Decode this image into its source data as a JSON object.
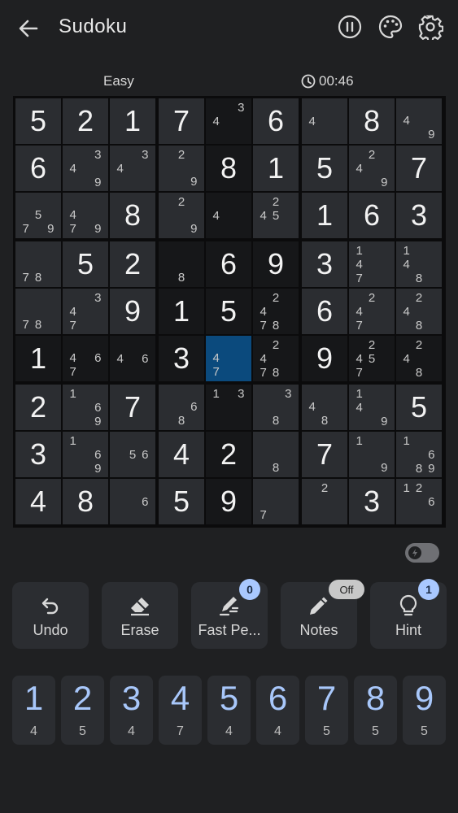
{
  "app": {
    "title": "Sudoku"
  },
  "toolbar": {
    "back_icon": "arrow-left-icon",
    "pause_icon": "pause-icon",
    "theme_icon": "palette-icon",
    "settings_icon": "gear-icon"
  },
  "status": {
    "difficulty": "Easy",
    "timer": "00:46"
  },
  "colors": {
    "background": "#1f2022",
    "cell_prefilled": "#2b2d31",
    "cell_dark": "#161719",
    "cell_selected": "#0b4a7d",
    "accent": "#a8c7fa"
  },
  "board": {
    "selected": [
      5,
      4
    ],
    "dark_cells": [
      [
        0,
        4
      ],
      [
        1,
        4
      ],
      [
        2,
        4
      ],
      [
        3,
        4
      ],
      [
        4,
        4
      ],
      [
        6,
        4
      ],
      [
        7,
        4
      ],
      [
        8,
        4
      ],
      [
        5,
        0
      ],
      [
        5,
        1
      ],
      [
        5,
        2
      ],
      [
        5,
        3
      ],
      [
        5,
        5
      ],
      [
        5,
        6
      ],
      [
        5,
        7
      ],
      [
        5,
        8
      ],
      [
        3,
        3
      ],
      [
        3,
        5
      ],
      [
        4,
        3
      ],
      [
        4,
        5
      ]
    ],
    "values": [
      [
        5,
        2,
        1,
        7,
        0,
        6,
        0,
        8,
        0
      ],
      [
        6,
        0,
        0,
        0,
        8,
        1,
        5,
        0,
        7
      ],
      [
        0,
        0,
        8,
        0,
        0,
        0,
        1,
        6,
        3
      ],
      [
        0,
        5,
        2,
        0,
        6,
        9,
        3,
        0,
        0
      ],
      [
        0,
        0,
        9,
        1,
        5,
        0,
        6,
        0,
        0
      ],
      [
        1,
        0,
        0,
        3,
        0,
        0,
        9,
        0,
        0
      ],
      [
        2,
        0,
        7,
        0,
        0,
        0,
        0,
        0,
        5
      ],
      [
        3,
        0,
        0,
        4,
        2,
        0,
        7,
        0,
        0
      ],
      [
        4,
        8,
        0,
        5,
        9,
        0,
        0,
        3,
        0
      ]
    ],
    "notes": [
      [
        [],
        [],
        [],
        [],
        [
          4,
          3
        ],
        [],
        [
          4
        ],
        [],
        [
          4,
          9
        ]
      ],
      [
        [],
        [
          4,
          3,
          9
        ],
        [
          4,
          3
        ],
        [
          2,
          9
        ],
        [],
        [],
        [],
        [
          4,
          2,
          9
        ],
        []
      ],
      [
        [
          5,
          7,
          9
        ],
        [
          4,
          7,
          9
        ],
        [],
        [
          2,
          9
        ],
        [
          4
        ],
        [
          4,
          2,
          5
        ],
        [],
        [],
        []
      ],
      [
        [
          7,
          8
        ],
        [],
        [],
        [
          8
        ],
        [],
        [],
        [],
        [
          1,
          4,
          7
        ],
        [
          1,
          4,
          8
        ]
      ],
      [
        [
          7,
          8
        ],
        [
          4,
          3,
          7
        ],
        [],
        [],
        [],
        [
          2,
          4,
          7,
          8
        ],
        [],
        [
          2,
          4,
          7
        ],
        [
          2,
          4,
          8
        ]
      ],
      [
        [],
        [
          4,
          6,
          7
        ],
        [
          4,
          6
        ],
        [],
        [
          4,
          7
        ],
        [
          2,
          4,
          7,
          8
        ],
        [],
        [
          2,
          4,
          5,
          7
        ],
        [
          2,
          4,
          8
        ]
      ],
      [
        [],
        [
          1,
          6,
          9
        ],
        [],
        [
          6,
          8
        ],
        [
          1,
          3
        ],
        [
          3,
          8
        ],
        [
          4,
          8
        ],
        [
          1,
          4,
          9
        ],
        []
      ],
      [
        [],
        [
          1,
          6,
          9
        ],
        [
          5,
          6
        ],
        [],
        [],
        [
          8
        ],
        [],
        [
          1,
          9
        ],
        [
          1,
          6,
          8,
          9
        ]
      ],
      [
        [],
        [],
        [
          6
        ],
        [],
        [],
        [
          7
        ],
        [
          2
        ],
        [],
        [
          1,
          2,
          6
        ]
      ]
    ]
  },
  "actions": [
    {
      "label": "Undo",
      "icon": "undo-icon"
    },
    {
      "label": "Erase",
      "icon": "eraser-icon"
    },
    {
      "label": "Fast Pe...",
      "icon": "fast-pencil-icon",
      "badge": "0"
    },
    {
      "label": "Notes",
      "icon": "pencil-icon",
      "pill": "Off"
    },
    {
      "label": "Hint",
      "icon": "lightbulb-icon",
      "badge": "1"
    }
  ],
  "numpad": [
    {
      "digit": "1",
      "count": "4"
    },
    {
      "digit": "2",
      "count": "5"
    },
    {
      "digit": "3",
      "count": "4"
    },
    {
      "digit": "4",
      "count": "7"
    },
    {
      "digit": "5",
      "count": "4"
    },
    {
      "digit": "6",
      "count": "4"
    },
    {
      "digit": "7",
      "count": "5"
    },
    {
      "digit": "8",
      "count": "5"
    },
    {
      "digit": "9",
      "count": "5"
    }
  ]
}
